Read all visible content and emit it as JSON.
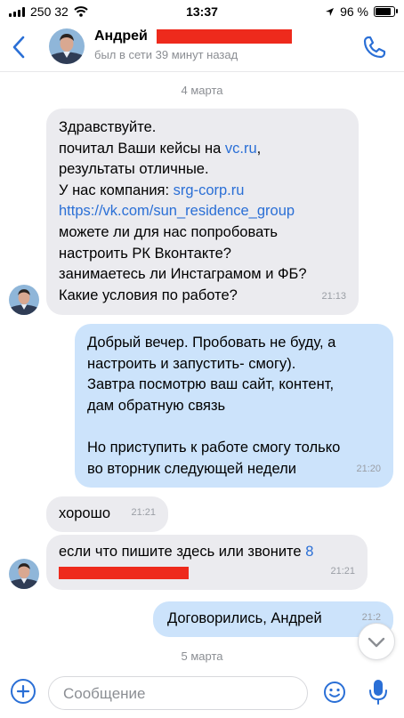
{
  "status_bar": {
    "carrier": "250 32",
    "time": "13:37",
    "battery_text": "96 %",
    "battery_level": 0.96
  },
  "header": {
    "name": "Андрей",
    "last_seen": "был в сети 39 минут назад"
  },
  "dates": [
    "4 марта",
    "5 марта"
  ],
  "messages": [
    {
      "dir": "in",
      "lines": [
        "Здравствуйте.",
        "почитал Ваши кейсы на ",
        "vc.ru",
        ",",
        "результаты отличные.",
        "У нас компания: ",
        "srg-corp.ru",
        "https://vk.com/sun_residence_group",
        "можете ли для нас попробовать",
        "настроить РК Вконтакте?",
        "занимаетесь ли Инстаграмом и ФБ?",
        "Какие условия по работе?"
      ],
      "time": "21:13"
    },
    {
      "dir": "out",
      "lines": [
        "Добрый вечер. Пробовать не буду, а",
        "настроить и запустить- смогу).",
        "Завтра посмотрю ваш сайт, контент,",
        "дам обратную связь",
        "",
        "Но приступить к работе смогу только",
        "во вторник следующей недели"
      ],
      "time": "21:20"
    },
    {
      "dir": "in",
      "text": "хорошо",
      "time": "21:21"
    },
    {
      "dir": "in",
      "text": "если что пишите здесь или звоните ",
      "phone_prefix": "8",
      "time": "21:21"
    },
    {
      "dir": "out",
      "text": "Договорились, Андрей",
      "time": "21:2"
    }
  ],
  "input": {
    "placeholder": "Сообщение"
  },
  "colors": {
    "accent": "#2a6fd6",
    "incoming_bubble": "#ebebef",
    "outgoing_bubble": "#cce3fb",
    "redaction": "#ee2a1c"
  },
  "icons": [
    "back-chevron-icon",
    "phone-icon",
    "plus-icon",
    "emoji-icon",
    "microphone-icon",
    "chevron-down-icon",
    "wifi-icon",
    "location-arrow-icon"
  ]
}
